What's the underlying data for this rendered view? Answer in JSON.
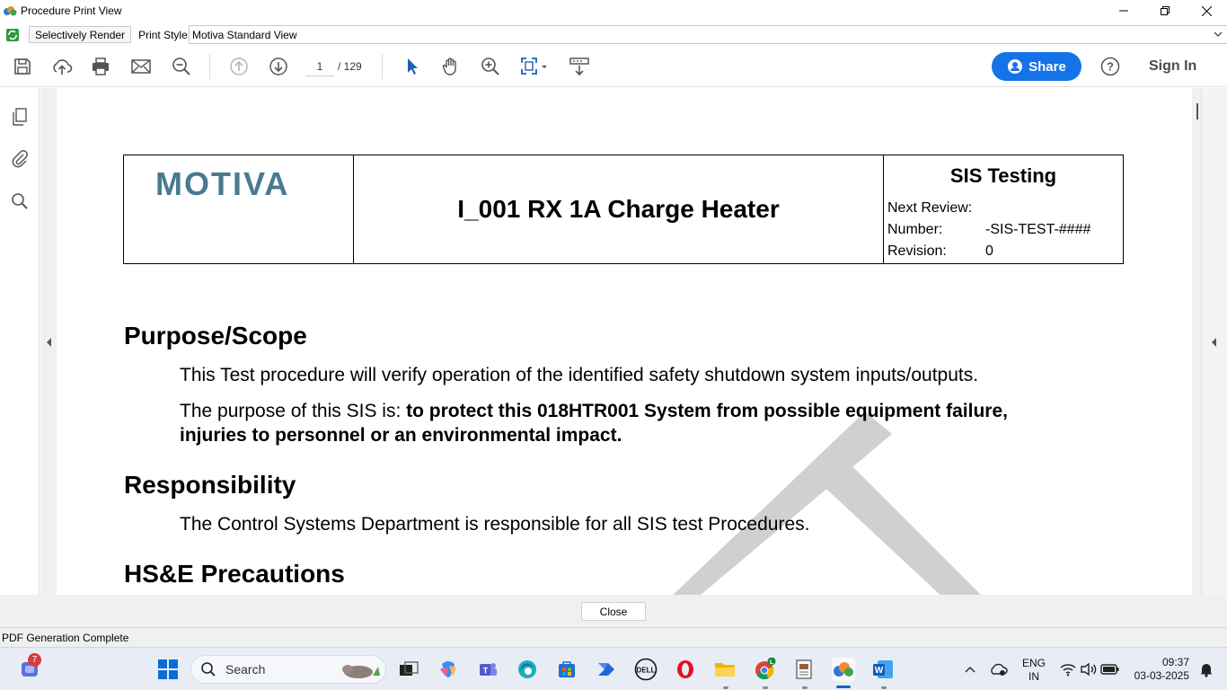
{
  "window": {
    "title": "Procedure Print View"
  },
  "app_toolbar": {
    "selectively_render": "Selectively Render",
    "print_style_label": "Print Style:",
    "print_style_value": "Motiva Standard View"
  },
  "pdf_toolbar": {
    "current_page": "1",
    "total_pages": "/ 129",
    "share_label": "Share",
    "sign_in_label": "Sign In"
  },
  "document": {
    "logo_text": "MOTIVA",
    "procedure_title": "I_001 RX 1A Charge Heater",
    "header_right_title": "SIS Testing",
    "next_review_label": "Next Review:",
    "next_review_value": "",
    "number_label": "Number:",
    "number_value": "-SIS-TEST-####",
    "revision_label": "Revision:",
    "revision_value": "0",
    "sections": {
      "purpose_heading": "Purpose/Scope",
      "purpose_p1": "This Test procedure will verify operation of the identified safety shutdown system inputs/outputs.",
      "purpose_p2_prefix": "The purpose of this SIS is: ",
      "purpose_p2_bold_line1": "to protect this 018HTR001 System from possible equipment failure,",
      "purpose_p2_bold_line2": "injuries to personnel or an environmental impact.",
      "responsibility_heading": "Responsibility",
      "responsibility_p1": "The Control Systems Department is responsible for all SIS test Procedures.",
      "hse_heading": "HS&E Precautions"
    }
  },
  "footer": {
    "close_label": "Close",
    "status_text": "PDF Generation Complete"
  },
  "taskbar": {
    "search_label": "Search",
    "notification_badge": "7",
    "chrome_badge": "L",
    "language_line1": "ENG",
    "language_line2": "IN",
    "time": "09:37",
    "date": "03-03-2025"
  },
  "colors": {
    "share_button": "#1473e6",
    "logo": "#4a7a92",
    "watermark": "#d0d0d0"
  }
}
